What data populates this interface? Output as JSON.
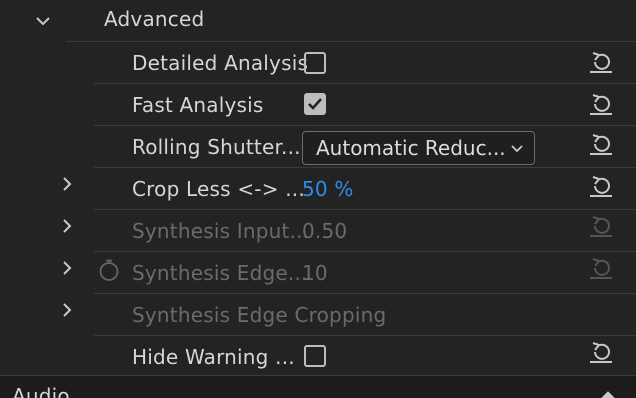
{
  "section": {
    "title": "Advanced"
  },
  "rows": [
    {
      "label": "Detailed Analysis",
      "checked": false,
      "dimmed": false
    },
    {
      "label": "Fast Analysis",
      "checked": true,
      "dimmed": false
    },
    {
      "label": "Rolling Shutter...",
      "select_value": "Automatic Reduc...",
      "dimmed": false
    },
    {
      "label": "Crop Less <-> ...",
      "value": "50 %",
      "dimmed": false
    },
    {
      "label": "Synthesis Input...",
      "value": "0.50",
      "dimmed": true
    },
    {
      "label": "Synthesis Edge...",
      "value": "10",
      "dimmed": true
    },
    {
      "label": "Synthesis Edge Cropping",
      "dimmed": true
    },
    {
      "label": "Hide Warning ...",
      "checked": false,
      "dimmed": false
    }
  ],
  "footer": {
    "title": "Audio"
  },
  "icons": {
    "expand": "chevron-right-icon",
    "collapse": "chevron-down-icon",
    "reset": "reset-icon",
    "stopwatch": "stopwatch-icon"
  },
  "colors": {
    "background": "#232323",
    "accent": "#2d8ceb",
    "text": "#d6d6d6",
    "disabled_text": "#6b6b6b"
  }
}
